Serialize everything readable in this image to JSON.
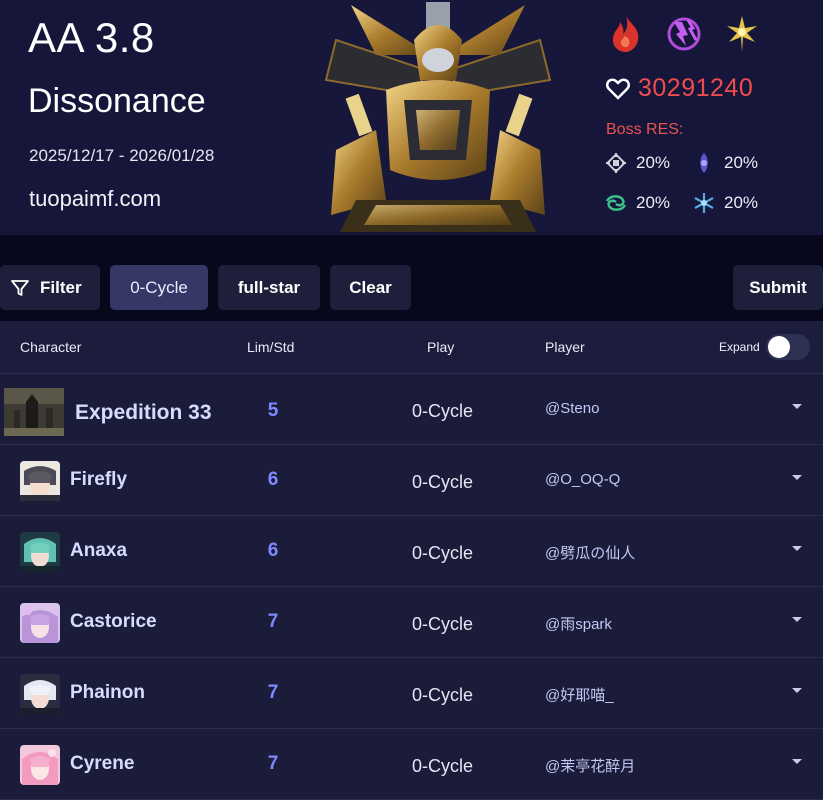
{
  "header": {
    "title": "AA 3.8",
    "subtitle": "Dissonance",
    "dates": "2025/12/17 - 2026/01/28",
    "site": "tuopaimf.com",
    "elements": [
      "fire-element-icon",
      "lightning-element-icon",
      "imaginary-element-icon"
    ],
    "hp": "30291240",
    "res_title": "Boss RES:",
    "resistances": [
      {
        "icon": "physical-res-icon",
        "value": "20%"
      },
      {
        "icon": "quantum-res-icon",
        "value": "20%"
      },
      {
        "icon": "wind-res-icon",
        "value": "20%"
      },
      {
        "icon": "ice-res-icon",
        "value": "20%"
      }
    ],
    "colors": {
      "hp": "#ef4d4d",
      "res_title": "#e8544f",
      "background": "#15163a"
    }
  },
  "toolbar": {
    "filter": "Filter",
    "cycle": "0-Cycle",
    "star": "full-star",
    "clear": "Clear",
    "submit": "Submit"
  },
  "table": {
    "headers": {
      "character": "Character",
      "lim": "Lim/Std",
      "play": "Play",
      "player": "Player",
      "expand": "Expand"
    },
    "expand_on": false,
    "rows": [
      {
        "name": "Expedition 33",
        "lim": "5",
        "play": "0-Cycle",
        "player": "@Steno"
      },
      {
        "name": "Firefly",
        "lim": "6",
        "play": "0-Cycle",
        "player": "@O_OQ-Q"
      },
      {
        "name": "Anaxa",
        "lim": "6",
        "play": "0-Cycle",
        "player": "@劈瓜の仙人"
      },
      {
        "name": "Castorice",
        "lim": "7",
        "play": "0-Cycle",
        "player": "@雨spark"
      },
      {
        "name": "Phainon",
        "lim": "7",
        "play": "0-Cycle",
        "player": "@好耶喵_"
      },
      {
        "name": "Cyrene",
        "lim": "7",
        "play": "0-Cycle",
        "player": "@茉亭花醉月"
      }
    ]
  }
}
